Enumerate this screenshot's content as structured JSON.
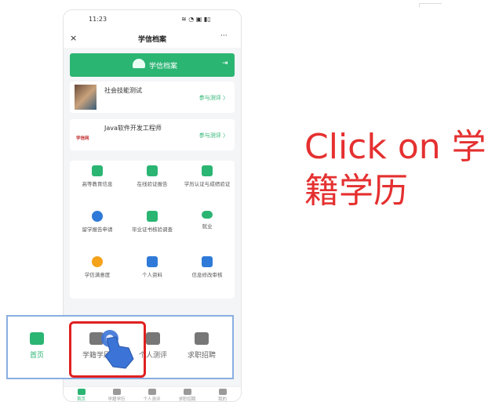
{
  "status_bar": {
    "time": "11:23",
    "indicators": "≋ ◔ ▣ ▮▯"
  },
  "title_bar": {
    "close": "×",
    "title": "学信档案",
    "more": "···"
  },
  "banner": {
    "label": "学信档案",
    "exit": "⇥"
  },
  "cards": [
    {
      "title": "社会技能测试",
      "link": "参与测评 〉"
    },
    {
      "brand": "学信网",
      "title": "Java软件开发工程师",
      "link": "参与测评 〉"
    }
  ],
  "grid": [
    {
      "label": "高等教育信息",
      "color": "#2bb573"
    },
    {
      "label": "在线验证报告",
      "color": "#2bb573"
    },
    {
      "label": "学历认证与成绩验证",
      "color": "#2bb573"
    },
    {
      "label": "留学报告申请",
      "color": "#2f7ad8"
    },
    {
      "label": "毕业证书核验调查",
      "color": "#2bb573"
    },
    {
      "label": "就业",
      "color": "#2bb573"
    },
    {
      "label": "学信满意度",
      "color": "#f4a21a"
    },
    {
      "label": "个人资料",
      "color": "#2f7ad8"
    },
    {
      "label": "信息修改审核",
      "color": "#2f7ad8"
    }
  ],
  "zoom_nav": [
    {
      "label": "首页",
      "active": true
    },
    {
      "label": "学籍学历",
      "active": false
    },
    {
      "label": "个人测评",
      "active": false
    },
    {
      "label": "求职招聘",
      "active": false
    }
  ],
  "bottom_nav": [
    {
      "label": "首页"
    },
    {
      "label": "学籍学历"
    },
    {
      "label": "个人测评"
    },
    {
      "label": "求职招聘"
    },
    {
      "label": "我的"
    }
  ],
  "instruction": "Click on 学籍学历",
  "colors": {
    "accent": "#2bb573",
    "highlight": "#e02020",
    "instruction": "#e53030",
    "zoom_border": "#8aaee0"
  }
}
